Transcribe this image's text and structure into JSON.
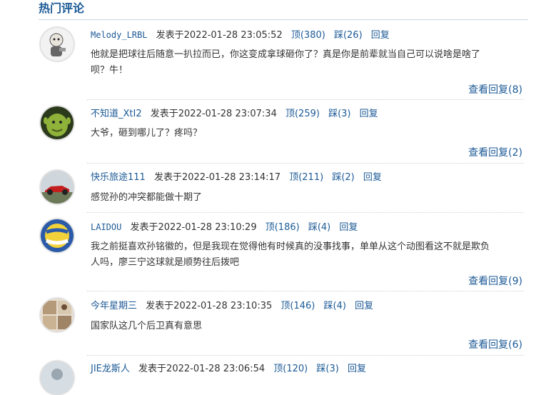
{
  "section": {
    "title": "热门评论"
  },
  "labels": {
    "posted_prefix": "发表于",
    "up": "顶",
    "down": "踩",
    "reply": "回复",
    "view_replies": "查看回复"
  },
  "comments": [
    {
      "user": "Melody_LRBL",
      "time": "2022-01-28 23:05:52",
      "up": "顶(380)",
      "down": "踩(26)",
      "reply": "回复",
      "lines": [
        "他就是把球往后随意一扒拉而已，你这变成拿球砸你了？真是你是前辈就当自己可以说啥是啥了",
        "呗？牛！"
      ],
      "view": "查看回复(8)",
      "avatar": "cartoon-character-icon"
    },
    {
      "user": "不知道_XtI2",
      "time": "2022-01-28 23:07:34",
      "up": "顶(259)",
      "down": "踩(3)",
      "reply": "回复",
      "lines": [
        "大爷，砸到哪儿了？疼吗？"
      ],
      "view": "查看回复(2)",
      "avatar": "green-ogre-icon"
    },
    {
      "user": "快乐旅途111",
      "time": "2022-01-28 23:14:17",
      "up": "顶(211)",
      "down": "踩(2)",
      "reply": "回复",
      "lines": [
        "感觉孙的冲突都能做十期了"
      ],
      "view": "",
      "avatar": "race-car-icon"
    },
    {
      "user": "LAIDOU",
      "time": "2022-01-28 23:10:29",
      "up": "顶(186)",
      "down": "踩(4)",
      "reply": "回复",
      "lines": [
        "我之前挺喜欢孙铭徽的，但是我现在觉得他有时候真的没事找事，单单从这个动图看这不就是欺负",
        "人吗，廖三宁这球就是顺势往后拨吧"
      ],
      "view": "查看回复(9)",
      "avatar": "volleyball-icon"
    },
    {
      "user": "今年星期三",
      "time": "2022-01-28 23:10:35",
      "up": "顶(146)",
      "down": "踩(4)",
      "reply": "回复",
      "lines": [
        "国家队这几个后卫真有意思"
      ],
      "view": "查看回复(6)",
      "avatar": "photo-collage-icon"
    },
    {
      "user": "JIE龙斯人",
      "time": "2022-01-28 23:06:54",
      "up": "顶(120)",
      "down": "踩(3)",
      "reply": "回复",
      "lines": [],
      "view": "",
      "avatar": "user-avatar-icon"
    }
  ]
}
